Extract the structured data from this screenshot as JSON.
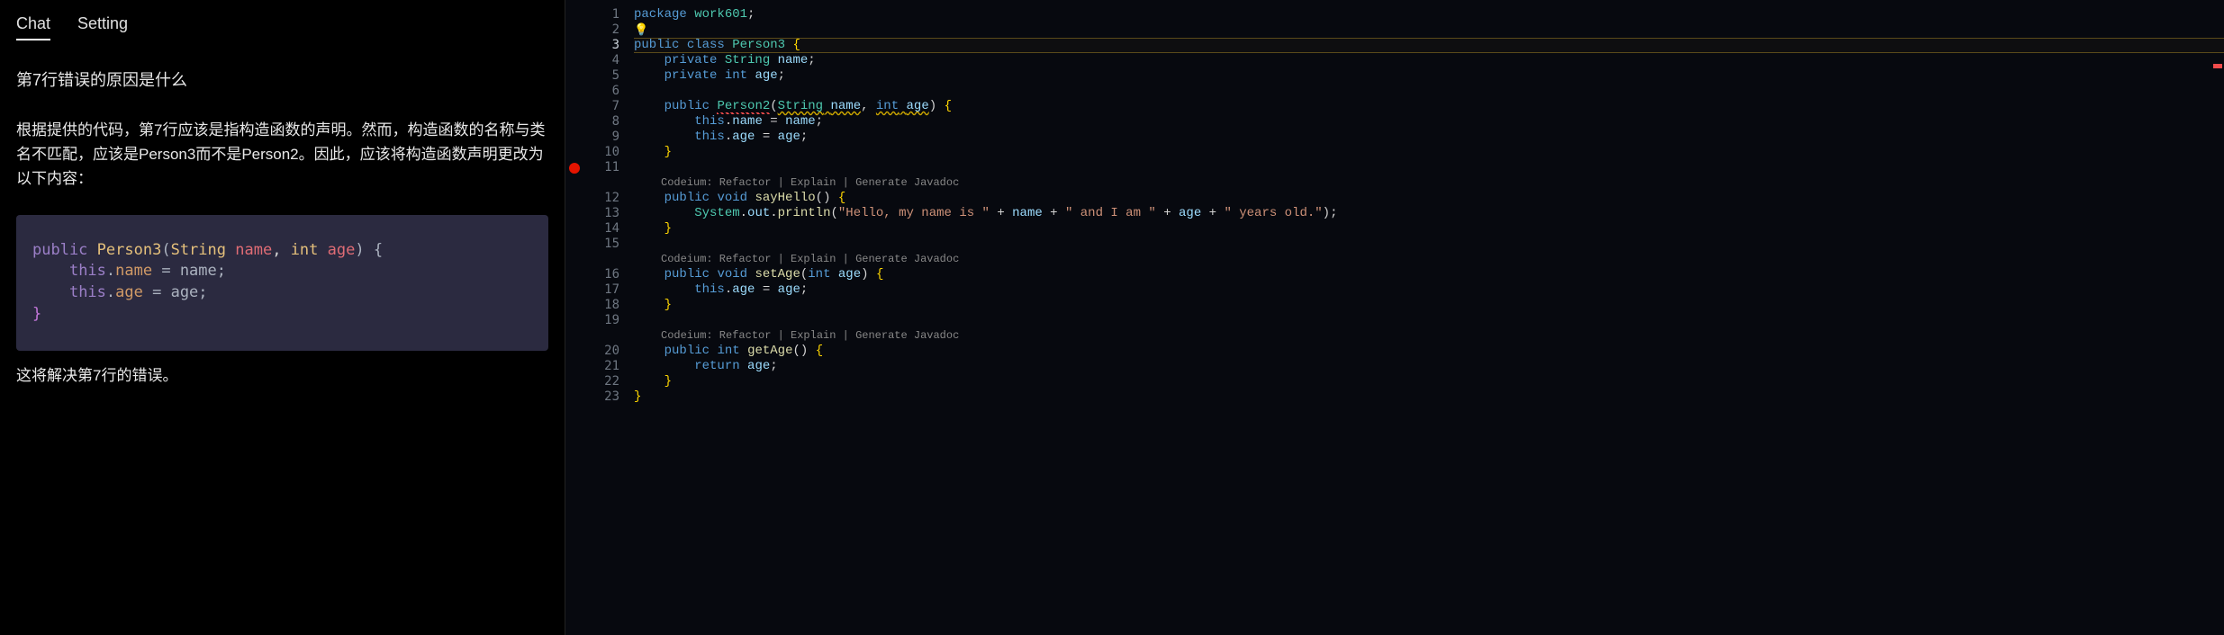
{
  "chat": {
    "tabs": [
      {
        "label": "Chat",
        "active": true
      },
      {
        "label": "Setting",
        "active": false
      }
    ],
    "question": "第7行错误的原因是什么",
    "answer_p1": "根据提供的代码，第7行应该是指构造函数的声明。然而，构造函数的名称与类名不匹配，应该是Person3而不是Person2。因此，应该将构造函数声明更改为以下内容：",
    "answer_p2": "这将解决第7行的错误。",
    "snippet": {
      "l1_kw": "public",
      "l1_cls": "Person3",
      "l1_paren": "(",
      "l1_t1": "String",
      "l1_v1": "name",
      "l1_t2": "int",
      "l1_v2": "age",
      "l1_end": ") {",
      "l2_this": "this",
      "l2_dot": ".",
      "l2_prop": "name",
      "l2_rest": " = name;",
      "l3_this": "this",
      "l3_dot": ".",
      "l3_prop": "age",
      "l3_rest": " = age;",
      "l4": "}"
    }
  },
  "editor": {
    "breakpoint_line": 11,
    "highlighted_line": 3,
    "codelens_label": "Codeium: Refactor | Explain | Generate Javadoc",
    "lines": [
      {
        "n": 1,
        "tokens": [
          [
            "tk-kw",
            "package"
          ],
          [
            "tk-punc",
            " "
          ],
          [
            "tk-pkg",
            "work601"
          ],
          [
            "tk-punc",
            ";"
          ]
        ]
      },
      {
        "n": 2,
        "lightbulb": true,
        "tokens": []
      },
      {
        "n": 3,
        "hl": true,
        "tokens": [
          [
            "tk-kw",
            "public"
          ],
          [
            "tk-punc",
            " "
          ],
          [
            "tk-kw",
            "class"
          ],
          [
            "tk-punc",
            " "
          ],
          [
            "tk-cls",
            "Person3"
          ],
          [
            "tk-punc",
            " "
          ],
          [
            "tk-brace",
            "{"
          ]
        ]
      },
      {
        "n": 4,
        "indent": 1,
        "tokens": [
          [
            "tk-kw",
            "private"
          ],
          [
            "tk-punc",
            " "
          ],
          [
            "tk-type",
            "String"
          ],
          [
            "tk-punc",
            " "
          ],
          [
            "tk-var",
            "name"
          ],
          [
            "tk-punc",
            ";"
          ]
        ]
      },
      {
        "n": 5,
        "indent": 1,
        "tokens": [
          [
            "tk-kw",
            "private"
          ],
          [
            "tk-punc",
            " "
          ],
          [
            "tk-kw",
            "int"
          ],
          [
            "tk-punc",
            " "
          ],
          [
            "tk-var",
            "age"
          ],
          [
            "tk-punc",
            ";"
          ]
        ]
      },
      {
        "n": 6,
        "tokens": []
      },
      {
        "n": 7,
        "indent": 1,
        "tokens": [
          [
            "tk-kw",
            "public"
          ],
          [
            "tk-punc",
            " "
          ],
          [
            "tk-err",
            "Person2"
          ],
          [
            "tk-punc",
            "("
          ],
          [
            "tk-type underline-warn",
            "String"
          ],
          [
            "tk-punc underline-warn",
            " "
          ],
          [
            "tk-var underline-warn",
            "name"
          ],
          [
            "tk-punc",
            ", "
          ],
          [
            "tk-kw underline-warn",
            "int"
          ],
          [
            "tk-punc underline-warn",
            " "
          ],
          [
            "tk-var underline-warn",
            "age"
          ],
          [
            "tk-punc",
            ") "
          ],
          [
            "tk-brace",
            "{"
          ]
        ]
      },
      {
        "n": 8,
        "indent": 2,
        "tokens": [
          [
            "tk-this",
            "this"
          ],
          [
            "tk-punc",
            "."
          ],
          [
            "tk-var",
            "name"
          ],
          [
            "tk-punc",
            " = "
          ],
          [
            "tk-var",
            "name"
          ],
          [
            "tk-punc",
            ";"
          ]
        ]
      },
      {
        "n": 9,
        "indent": 2,
        "tokens": [
          [
            "tk-this",
            "this"
          ],
          [
            "tk-punc",
            "."
          ],
          [
            "tk-var",
            "age"
          ],
          [
            "tk-punc",
            " = "
          ],
          [
            "tk-var",
            "age"
          ],
          [
            "tk-punc",
            ";"
          ]
        ]
      },
      {
        "n": 10,
        "indent": 1,
        "tokens": [
          [
            "tk-brace",
            "}"
          ]
        ]
      },
      {
        "n": 11,
        "tokens": []
      },
      {
        "codelens": true
      },
      {
        "n": 12,
        "indent": 1,
        "tokens": [
          [
            "tk-kw",
            "public"
          ],
          [
            "tk-punc",
            " "
          ],
          [
            "tk-kw",
            "void"
          ],
          [
            "tk-punc",
            " "
          ],
          [
            "tk-meth",
            "sayHello"
          ],
          [
            "tk-punc",
            "() "
          ],
          [
            "tk-brace",
            "{"
          ]
        ]
      },
      {
        "n": 13,
        "indent": 2,
        "tokens": [
          [
            "tk-type",
            "System"
          ],
          [
            "tk-punc",
            "."
          ],
          [
            "tk-var",
            "out"
          ],
          [
            "tk-punc",
            "."
          ],
          [
            "tk-meth",
            "println"
          ],
          [
            "tk-punc",
            "("
          ],
          [
            "tk-str",
            "\"Hello, my name is \""
          ],
          [
            "tk-punc",
            " + "
          ],
          [
            "tk-var",
            "name"
          ],
          [
            "tk-punc",
            " + "
          ],
          [
            "tk-str",
            "\" and I am \""
          ],
          [
            "tk-punc",
            " + "
          ],
          [
            "tk-var",
            "age"
          ],
          [
            "tk-punc",
            " + "
          ],
          [
            "tk-str",
            "\" years old.\""
          ],
          [
            "tk-punc",
            ");"
          ]
        ]
      },
      {
        "n": 14,
        "indent": 1,
        "tokens": [
          [
            "tk-brace",
            "}"
          ]
        ]
      },
      {
        "n": 15,
        "tokens": []
      },
      {
        "codelens": true
      },
      {
        "n": 16,
        "indent": 1,
        "tokens": [
          [
            "tk-kw",
            "public"
          ],
          [
            "tk-punc",
            " "
          ],
          [
            "tk-kw",
            "void"
          ],
          [
            "tk-punc",
            " "
          ],
          [
            "tk-meth",
            "setAge"
          ],
          [
            "tk-punc",
            "("
          ],
          [
            "tk-kw",
            "int"
          ],
          [
            "tk-punc",
            " "
          ],
          [
            "tk-var",
            "age"
          ],
          [
            "tk-punc",
            ") "
          ],
          [
            "tk-brace",
            "{"
          ]
        ]
      },
      {
        "n": 17,
        "indent": 2,
        "tokens": [
          [
            "tk-this",
            "this"
          ],
          [
            "tk-punc",
            "."
          ],
          [
            "tk-var",
            "age"
          ],
          [
            "tk-punc",
            " = "
          ],
          [
            "tk-var",
            "age"
          ],
          [
            "tk-punc",
            ";"
          ]
        ]
      },
      {
        "n": 18,
        "indent": 1,
        "tokens": [
          [
            "tk-brace",
            "}"
          ]
        ]
      },
      {
        "n": 19,
        "tokens": []
      },
      {
        "codelens": true
      },
      {
        "n": 20,
        "indent": 1,
        "tokens": [
          [
            "tk-kw",
            "public"
          ],
          [
            "tk-punc",
            " "
          ],
          [
            "tk-kw",
            "int"
          ],
          [
            "tk-punc",
            " "
          ],
          [
            "tk-meth",
            "getAge"
          ],
          [
            "tk-punc",
            "() "
          ],
          [
            "tk-brace",
            "{"
          ]
        ]
      },
      {
        "n": 21,
        "indent": 2,
        "tokens": [
          [
            "tk-kw",
            "return"
          ],
          [
            "tk-punc",
            " "
          ],
          [
            "tk-var",
            "age"
          ],
          [
            "tk-punc",
            ";"
          ]
        ]
      },
      {
        "n": 22,
        "indent": 1,
        "tokens": [
          [
            "tk-brace",
            "}"
          ]
        ]
      },
      {
        "n": 23,
        "tokens": [
          [
            "tk-brace",
            "}"
          ]
        ]
      }
    ]
  }
}
